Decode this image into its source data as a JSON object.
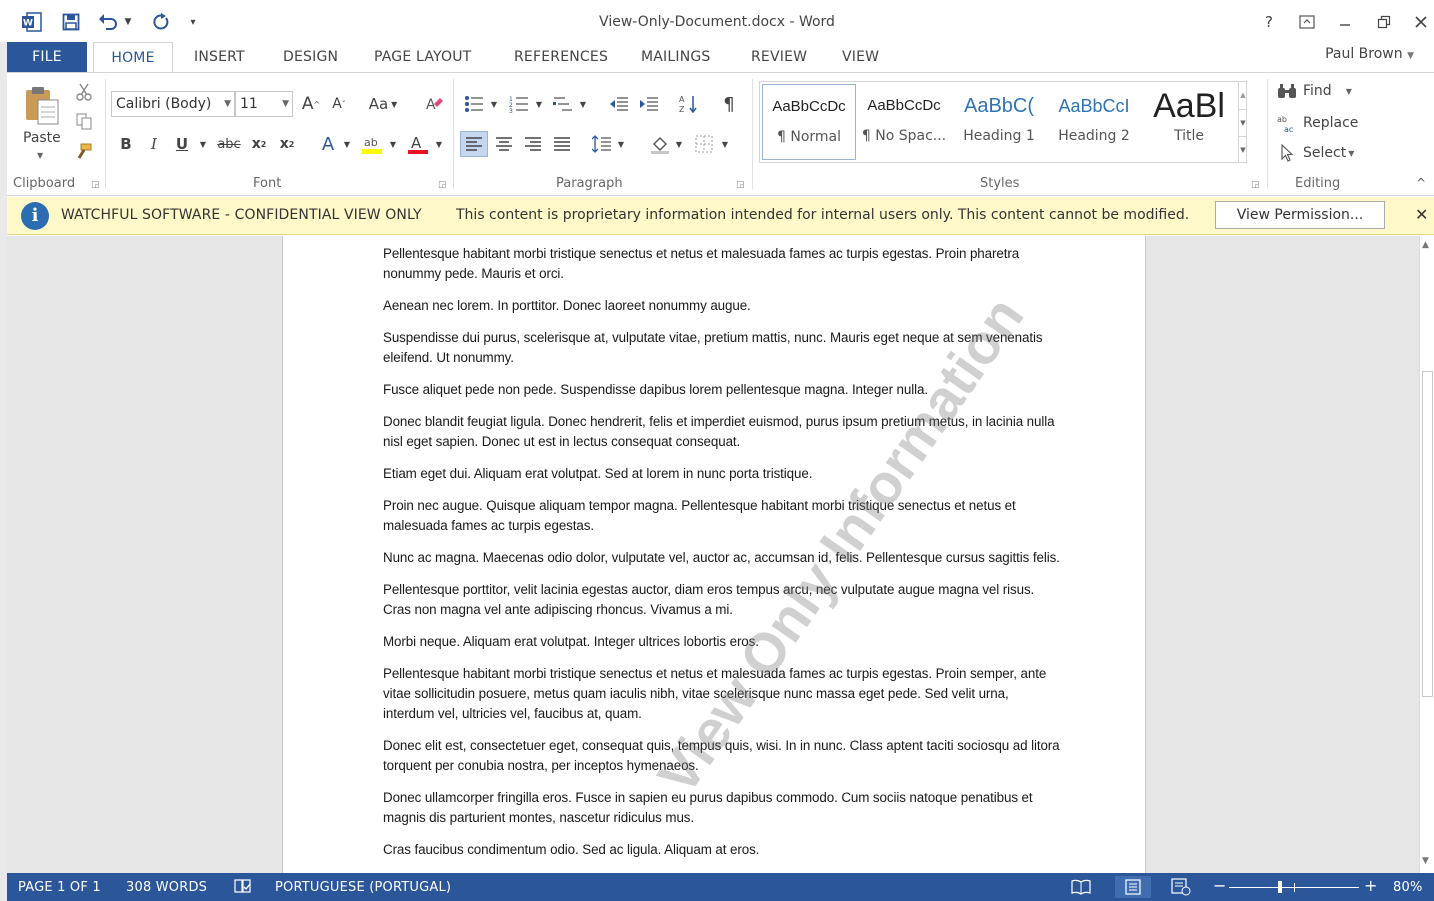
{
  "window": {
    "title": "View-Only-Document.docx - Word",
    "help": "?",
    "user": "Paul Brown"
  },
  "tabs": [
    "FILE",
    "HOME",
    "INSERT",
    "DESIGN",
    "PAGE LAYOUT",
    "REFERENCES",
    "MAILINGS",
    "REVIEW",
    "VIEW"
  ],
  "ribbon": {
    "clipboard": {
      "label": "Clipboard",
      "paste": "Paste"
    },
    "font": {
      "label": "Font",
      "name": "Calibri (Body)",
      "size": "11",
      "case": "Aa"
    },
    "paragraph": {
      "label": "Paragraph"
    },
    "styles": {
      "label": "Styles",
      "items": [
        {
          "sample": "AaBbCcDc",
          "name": "¶ Normal"
        },
        {
          "sample": "AaBbCcDc",
          "name": "¶ No Spac..."
        },
        {
          "sample": "AaBbC(",
          "name": "Heading 1"
        },
        {
          "sample": "AaBbCcI",
          "name": "Heading 2"
        },
        {
          "sample": "AaBl",
          "name": "Title"
        }
      ]
    },
    "editing": {
      "label": "Editing",
      "find": "Find",
      "replace": "Replace",
      "select": "Select"
    }
  },
  "infobar": {
    "title": "WATCHFUL SOFTWARE - CONFIDENTIAL VIEW ONLY",
    "message": "This content is proprietary information intended for internal users only. This content cannot be modified.",
    "button": "View Permission...",
    "close": "✕"
  },
  "document": {
    "watermark": "View Only Information",
    "paragraphs": [
      "Pellentesque habitant morbi tristique senectus et netus et malesuada fames ac turpis egestas. Proin pharetra nonummy pede. Mauris et orci.",
      "Aenean nec lorem. In porttitor. Donec laoreet nonummy augue.",
      "Suspendisse dui purus, scelerisque at, vulputate vitae, pretium mattis, nunc. Mauris eget neque at sem venenatis eleifend. Ut nonummy.",
      "Fusce aliquet pede non pede. Suspendisse dapibus lorem pellentesque magna. Integer nulla.",
      "Donec blandit feugiat ligula. Donec hendrerit, felis et imperdiet euismod, purus ipsum pretium metus, in lacinia nulla nisl eget sapien. Donec ut est in lectus consequat consequat.",
      "Etiam eget dui. Aliquam erat volutpat. Sed at lorem in nunc porta tristique.",
      "Proin nec augue. Quisque aliquam tempor magna. Pellentesque habitant morbi tristique senectus et netus et malesuada fames ac turpis egestas.",
      "Nunc ac magna. Maecenas odio dolor, vulputate vel, auctor ac, accumsan id, felis. Pellentesque cursus sagittis felis.",
      "Pellentesque porttitor, velit lacinia egestas auctor, diam eros tempus arcu, nec vulputate augue magna vel risus. Cras non magna vel ante adipiscing rhoncus. Vivamus a mi.",
      "Morbi neque. Aliquam erat volutpat. Integer ultrices lobortis eros.",
      "Pellentesque habitant morbi tristique senectus et netus et malesuada fames ac turpis egestas. Proin semper, ante vitae sollicitudin posuere, metus quam iaculis nibh, vitae scelerisque nunc massa eget pede. Sed velit urna, interdum vel, ultricies vel, faucibus at, quam.",
      "Donec elit est, consectetuer eget, consequat quis, tempus quis, wisi. In in nunc. Class aptent taciti sociosqu ad litora torquent per conubia nostra, per inceptos hymenaeos.",
      "Donec ullamcorper fringilla eros. Fusce in sapien eu purus dapibus commodo. Cum sociis natoque penatibus et magnis dis parturient montes, nascetur ridiculus mus.",
      "Cras faucibus condimentum odio. Sed ac ligula. Aliquam at eros."
    ]
  },
  "status": {
    "page": "PAGE 1 OF 1",
    "words": "308 WORDS",
    "language": "PORTUGUESE (PORTUGAL)",
    "zoom": "80%"
  },
  "colors": {
    "accent": "#2b579a",
    "infobar": "#fff9c9",
    "info_icon": "#2b6cb3",
    "font_color": "#e81123",
    "highlight": "#ffff00"
  }
}
